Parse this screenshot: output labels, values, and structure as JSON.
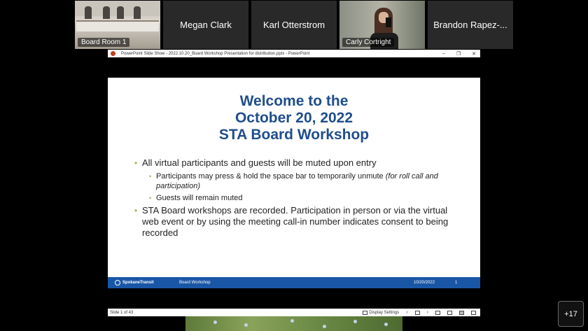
{
  "participants": [
    {
      "name": "Board Room 1",
      "video": true
    },
    {
      "name": "Megan Clark",
      "video": false
    },
    {
      "name": "Karl Otterstrom",
      "video": false
    },
    {
      "name": "Carly Cortright",
      "video": true
    },
    {
      "name": "Brandon Rapez-...",
      "video": false
    }
  ],
  "ppt_window": {
    "title": "PowerPoint Slide Show  -  2022.10.20_Board Workshop Presentation for distribution.pptx  -  PowerPoint",
    "controls": {
      "minimize": "–",
      "restore": "❐",
      "close": "✕"
    }
  },
  "slide": {
    "title_lines": [
      "Welcome to the",
      "October 20, 2022",
      "STA Board Workshop"
    ],
    "bullet1": "All virtual participants and guests will be muted upon entry",
    "sub1_text": "Participants may press & hold the space bar to temporarily unmute ",
    "sub1_italic": "(for roll call and participation)",
    "sub2": "Guests will remain muted",
    "bullet2": "STA Board workshops are recorded. Participation in person or via the virtual web event or by using the meeting call-in number indicates consent to being recorded",
    "footer": {
      "logo": "SpokaneTransit",
      "title": "Board Workshop",
      "date": "10/20/2022",
      "page": "1"
    }
  },
  "status_bar": {
    "slide_count": "Slide 1 of 43",
    "display_settings": "Display Settings",
    "prev": "‹",
    "next": "›"
  },
  "overflow": {
    "label": "+17"
  }
}
